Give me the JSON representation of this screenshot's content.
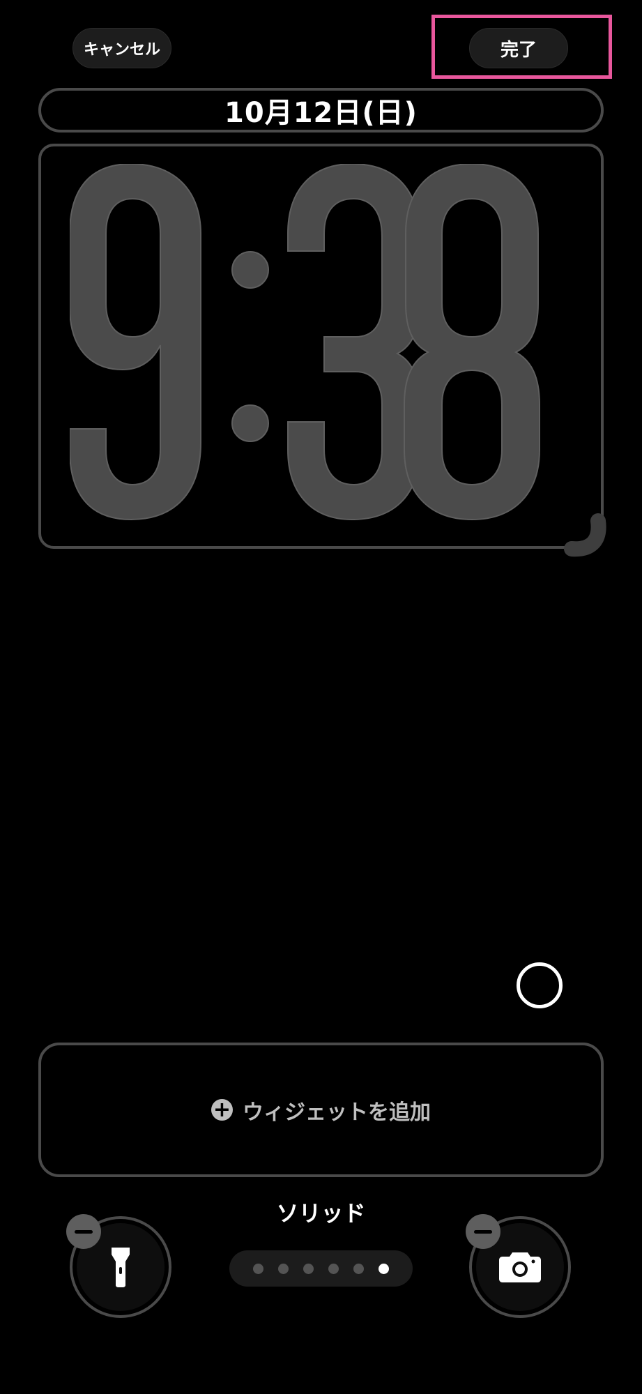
{
  "header": {
    "cancel_label": "キャンセル",
    "done_label": "完了"
  },
  "lock_screen": {
    "date": "10月12日(日)",
    "time": "9:38"
  },
  "widgets": {
    "add_label": "ウィジェットを追加",
    "add_icon": "+"
  },
  "style": {
    "name": "ソリッド",
    "page_count": 6,
    "active_page": 6
  },
  "shortcuts": {
    "left": "flashlight-icon",
    "right": "camera-icon"
  },
  "colors": {
    "highlight": "#e8579c",
    "clock": "#4b4b4b",
    "background": "#000000"
  }
}
